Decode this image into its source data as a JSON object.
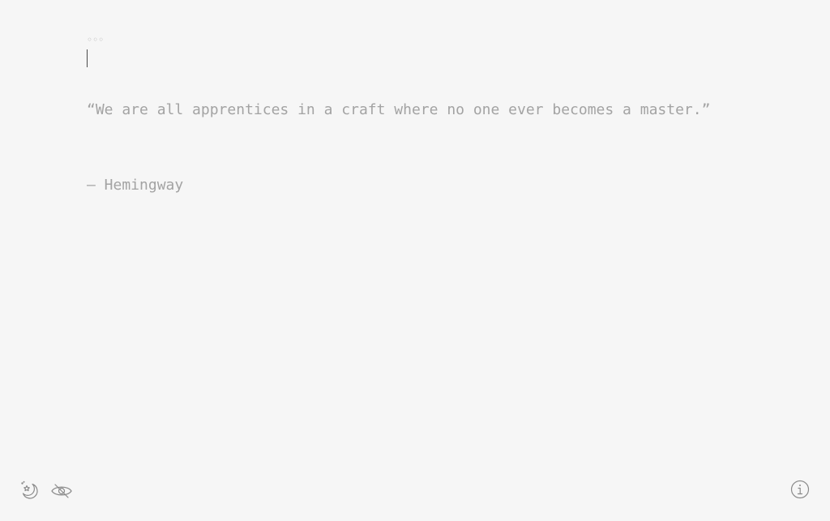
{
  "editor": {
    "status_dots": "◦◦◦",
    "lines": [
      "“We are all apprentices in a craft where no one ever becomes a master.”",
      "— Hemingway"
    ]
  },
  "toolbar": {
    "night_mode_icon": "moon-star-icon",
    "focus_mode_icon": "eye-slash-icon",
    "info_icon": "info-icon"
  },
  "colors": {
    "background": "#f6f6f6",
    "text": "#a3a3a3",
    "icon": "#8a8a8a",
    "caret": "#4a4a4a"
  }
}
